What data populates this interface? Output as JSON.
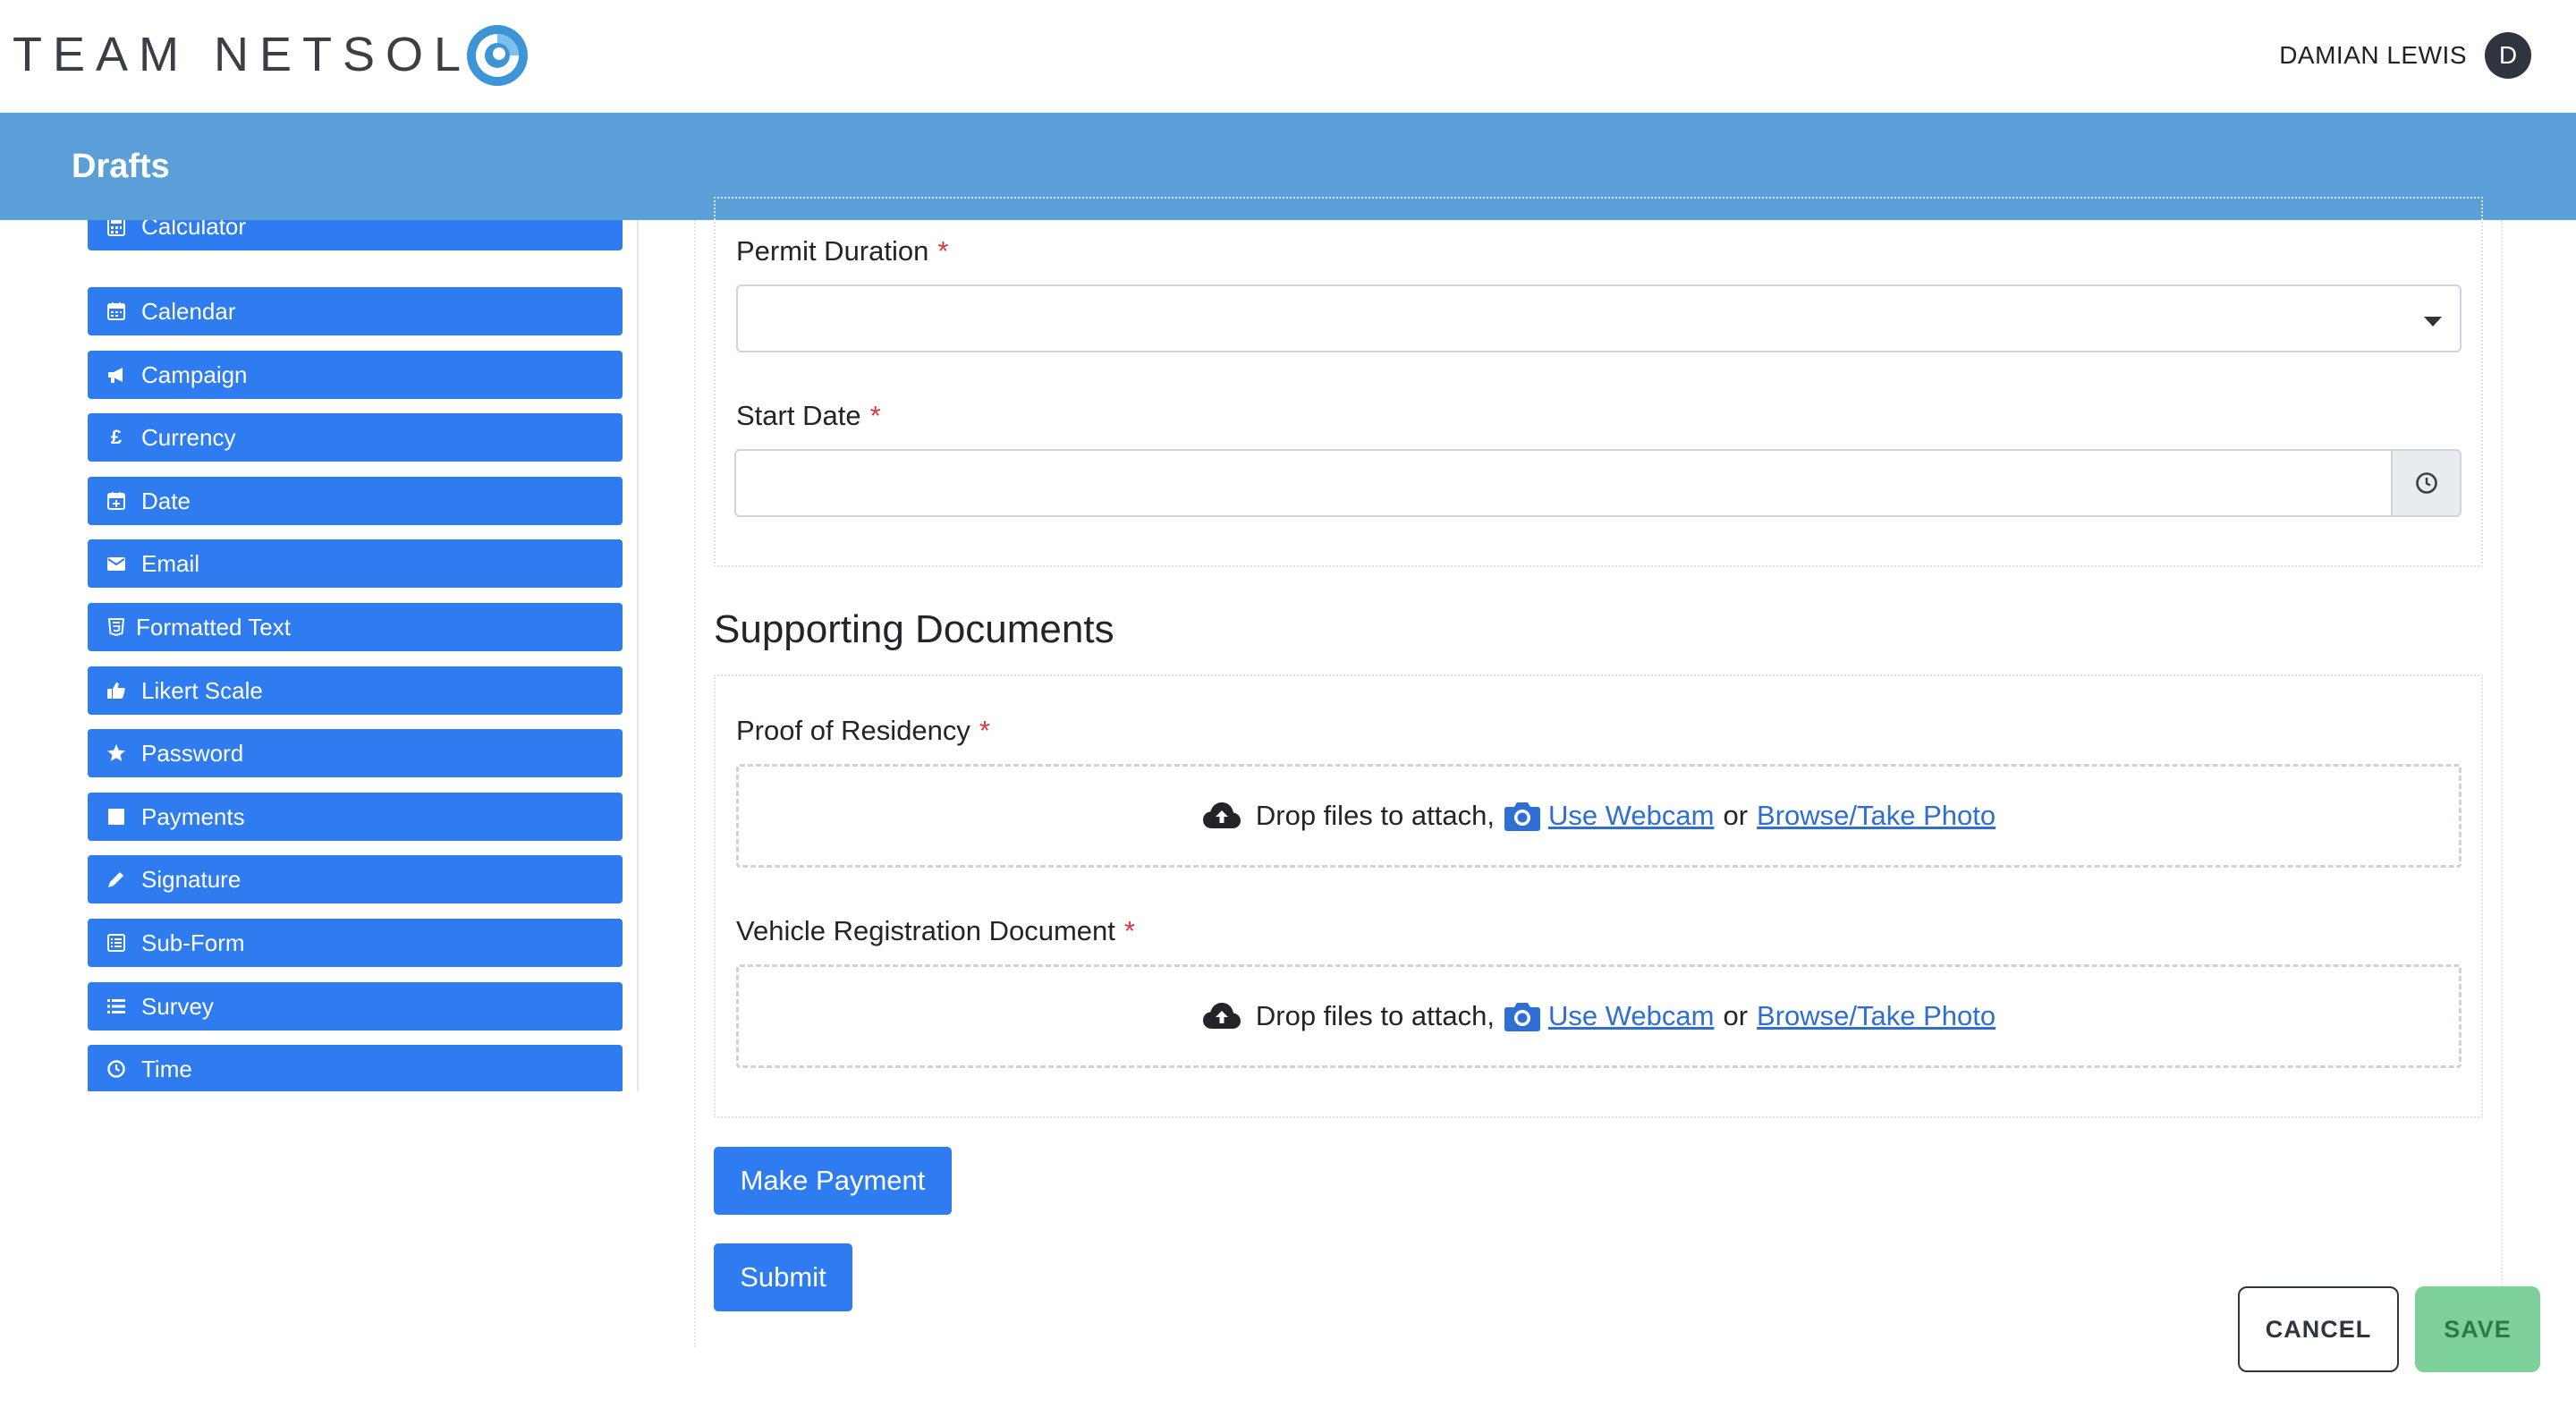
{
  "header": {
    "brand": "TEAM NETSOL",
    "user_name": "DAMIAN LEWIS",
    "user_initial": "D"
  },
  "titlebar": {
    "title": "Drafts"
  },
  "palette": {
    "items": [
      {
        "label": "Calculator",
        "icon": "calculator-icon"
      },
      {
        "label": "Calendar",
        "icon": "calendar-icon"
      },
      {
        "label": "Campaign",
        "icon": "bullhorn-icon"
      },
      {
        "label": "Currency",
        "icon": "pound-icon"
      },
      {
        "label": "Date",
        "icon": "calendar-plus-icon"
      },
      {
        "label": "Email",
        "icon": "envelope-icon"
      },
      {
        "label": "Formatted Text",
        "icon": "html5-icon"
      },
      {
        "label": "Likert Scale",
        "icon": "thumbs-up-icon"
      },
      {
        "label": "Password",
        "icon": "star-icon"
      },
      {
        "label": "Payments",
        "icon": "square-icon"
      },
      {
        "label": "Signature",
        "icon": "pencil-icon"
      },
      {
        "label": "Sub-Form",
        "icon": "list-alt-icon"
      },
      {
        "label": "Survey",
        "icon": "list-icon"
      },
      {
        "label": "Time",
        "icon": "clock-icon"
      }
    ]
  },
  "form": {
    "permit_duration": {
      "label": "Permit Duration",
      "required": "*",
      "value": ""
    },
    "start_date": {
      "label": "Start Date",
      "required": "*",
      "value": ""
    },
    "supporting_documents": {
      "title": "Supporting Documents",
      "proof_of_residency": {
        "label": "Proof of Residency",
        "required": "*"
      },
      "vehicle_registration": {
        "label": "Vehicle Registration Document",
        "required": "*"
      },
      "dropzone": {
        "drop_text": "Drop files to attach,",
        "webcam_link": "Use Webcam",
        "or_text": "or",
        "browse_link": "Browse/Take Photo"
      }
    },
    "make_payment_label": "Make Payment",
    "submit_label": "Submit"
  },
  "footer": {
    "cancel_label": "CANCEL",
    "save_label": "SAVE"
  },
  "colors": {
    "titlebar": "#5b9fd8",
    "primary_button": "#2e7cf0",
    "save_button": "#7ed09a",
    "required_star": "#dc3545",
    "link": "#2e6fd1"
  }
}
